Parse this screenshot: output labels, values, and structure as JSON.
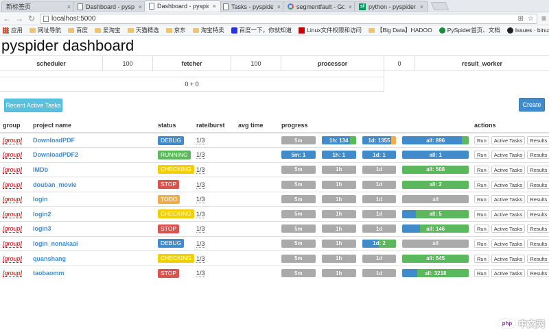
{
  "browser": {
    "tabs": [
      {
        "label": "新标签页",
        "icon": "none",
        "active": false
      },
      {
        "label": "Dashboard - pyspider",
        "icon": "doc",
        "active": false
      },
      {
        "label": "Dashboard - pyspider",
        "icon": "doc",
        "active": true
      },
      {
        "label": "Tasks - pyspider",
        "icon": "doc",
        "active": false
      },
      {
        "label": "segmentfault - Google",
        "icon": "google",
        "active": false
      },
      {
        "label": "python - pyspider爬虫",
        "icon": "sf",
        "active": false
      }
    ],
    "url": "localhost:5000",
    "bookmarks": [
      {
        "label": "应用",
        "icon": "apps"
      },
      {
        "label": "网址导航",
        "icon": "folder"
      },
      {
        "label": "百度",
        "icon": "folder"
      },
      {
        "label": "爱淘宝",
        "icon": "folder"
      },
      {
        "label": "天猫精选",
        "icon": "folder"
      },
      {
        "label": "京东",
        "icon": "folder"
      },
      {
        "label": "淘宝特卖",
        "icon": "folder"
      },
      {
        "label": "百度一下，你就知道",
        "icon": "baidu"
      },
      {
        "label": "Linux文件权限和访问",
        "icon": "red"
      },
      {
        "label": "【Big Data】HADOO",
        "icon": "folder"
      },
      {
        "label": "PySpider首页、文档",
        "icon": "green"
      },
      {
        "label": "Issues · binux/pysp",
        "icon": "github"
      }
    ]
  },
  "page": {
    "title": "pyspider dashboard",
    "stats": {
      "scheduler_label": "scheduler",
      "scheduler_value": "100",
      "fetcher_label": "fetcher",
      "fetcher_value": "100",
      "processor_label": "processor",
      "processor_value": "0",
      "result_worker_label": "result_worker",
      "fetcher_rate": "0 + 0"
    },
    "recent_button": "Recent Active Tasks",
    "create_button": "Create",
    "columns": [
      "group",
      "project name",
      "status",
      "rate/burst",
      "avg time",
      "progress",
      "actions"
    ],
    "action_labels": {
      "run": "Run",
      "active_tasks": "Active Tasks",
      "results": "Results"
    },
    "status_colors": {
      "DEBUG": "#428bca",
      "RUNNING": "#5cb85c",
      "CHECKING": "#f0d000",
      "STOP": "#d9534f",
      "TODO": "#f0ad4e"
    },
    "progress_colors": {
      "success": "#5cb85c",
      "pending": "#428bca",
      "retry": "#f0ad4e",
      "failed": "#d9534f",
      "empty": "#aaaaaa"
    },
    "projects": [
      {
        "group": "[group]",
        "name": "DownloadPDF",
        "status": "DEBUG",
        "rate": "1/3",
        "avg_time": "",
        "progress": [
          {
            "label": "5m",
            "segments": []
          },
          {
            "label": "1h: 134",
            "segments": [
              {
                "type": "pending",
                "pct": 0.82
              },
              {
                "type": "success",
                "pct": 0.18
              }
            ]
          },
          {
            "label": "1d: 1355",
            "segments": [
              {
                "type": "pending",
                "pct": 0.85
              },
              {
                "type": "retry",
                "pct": 0.15
              }
            ]
          },
          {
            "label": "all: 896",
            "segments": [
              {
                "type": "pending",
                "pct": 0.9
              },
              {
                "type": "success",
                "pct": 0.1
              }
            ]
          }
        ]
      },
      {
        "group": "[group]",
        "name": "DownloadPDF2",
        "status": "RUNNING",
        "rate": "1/3",
        "avg_time": "",
        "progress": [
          {
            "label": "5m: 1",
            "segments": [
              {
                "type": "pending",
                "pct": 1.0
              }
            ]
          },
          {
            "label": "1h: 1",
            "segments": [
              {
                "type": "pending",
                "pct": 1.0
              }
            ]
          },
          {
            "label": "1d: 1",
            "segments": [
              {
                "type": "pending",
                "pct": 1.0
              }
            ]
          },
          {
            "label": "all: 1",
            "segments": [
              {
                "type": "pending",
                "pct": 1.0
              }
            ]
          }
        ]
      },
      {
        "group": "[group]",
        "name": "IMDb",
        "status": "CHECKING",
        "rate": "1/3",
        "avg_time": "",
        "progress": [
          {
            "label": "5m",
            "segments": []
          },
          {
            "label": "1h",
            "segments": []
          },
          {
            "label": "1d",
            "segments": []
          },
          {
            "label": "all: 508",
            "segments": [
              {
                "type": "success",
                "pct": 1.0
              }
            ]
          }
        ]
      },
      {
        "group": "[group]",
        "name": "douban_movie",
        "status": "STOP",
        "rate": "1/3",
        "avg_time": "",
        "progress": [
          {
            "label": "5m",
            "segments": []
          },
          {
            "label": "1h",
            "segments": []
          },
          {
            "label": "1d",
            "segments": []
          },
          {
            "label": "all: 2",
            "segments": [
              {
                "type": "success",
                "pct": 1.0
              }
            ]
          }
        ]
      },
      {
        "group": "[group]",
        "name": "login",
        "status": "TODO",
        "rate": "1/3",
        "avg_time": "",
        "progress": [
          {
            "label": "5m",
            "segments": []
          },
          {
            "label": "1h",
            "segments": []
          },
          {
            "label": "1d",
            "segments": []
          },
          {
            "label": "all",
            "segments": []
          }
        ]
      },
      {
        "group": "[group]",
        "name": "login2",
        "status": "CHECKING",
        "rate": "1/3",
        "avg_time": "",
        "progress": [
          {
            "label": "5m",
            "segments": []
          },
          {
            "label": "1h",
            "segments": []
          },
          {
            "label": "1d",
            "segments": []
          },
          {
            "label": "all: 5",
            "segments": [
              {
                "type": "pending",
                "pct": 0.2
              },
              {
                "type": "success",
                "pct": 0.8
              }
            ]
          }
        ]
      },
      {
        "group": "[group]",
        "name": "login3",
        "status": "STOP",
        "rate": "1/3",
        "avg_time": "",
        "progress": [
          {
            "label": "5m",
            "segments": []
          },
          {
            "label": "1h",
            "segments": []
          },
          {
            "label": "1d",
            "segments": []
          },
          {
            "label": "all: 146",
            "segments": [
              {
                "type": "pending",
                "pct": 0.27
              },
              {
                "type": "success",
                "pct": 0.73
              }
            ]
          }
        ]
      },
      {
        "group": "[group]",
        "name": "login_nonakaai",
        "status": "DEBUG",
        "rate": "1/3",
        "avg_time": "",
        "progress": [
          {
            "label": "5m",
            "segments": []
          },
          {
            "label": "1h",
            "segments": []
          },
          {
            "label": "1d: 2",
            "segments": [
              {
                "type": "pending",
                "pct": 0.5
              },
              {
                "type": "success",
                "pct": 0.5
              }
            ]
          },
          {
            "label": "all",
            "segments": []
          }
        ]
      },
      {
        "group": "[group]",
        "name": "quanshang",
        "status": "CHECKING",
        "rate": "1/3",
        "avg_time": "",
        "progress": [
          {
            "label": "5m",
            "segments": []
          },
          {
            "label": "1h",
            "segments": []
          },
          {
            "label": "1d",
            "segments": []
          },
          {
            "label": "all: 545",
            "segments": [
              {
                "type": "success",
                "pct": 1.0
              }
            ]
          }
        ]
      },
      {
        "group": "[group]",
        "name": "taobaomm",
        "status": "STOP",
        "rate": "1/3",
        "avg_time": "",
        "progress": [
          {
            "label": "5m",
            "segments": []
          },
          {
            "label": "1h",
            "segments": []
          },
          {
            "label": "1d",
            "segments": []
          },
          {
            "label": "all: 3218",
            "segments": [
              {
                "type": "pending",
                "pct": 0.22
              },
              {
                "type": "success",
                "pct": 0.78
              }
            ]
          }
        ]
      }
    ]
  },
  "watermark": {
    "logo": "php",
    "text": "中文网"
  }
}
